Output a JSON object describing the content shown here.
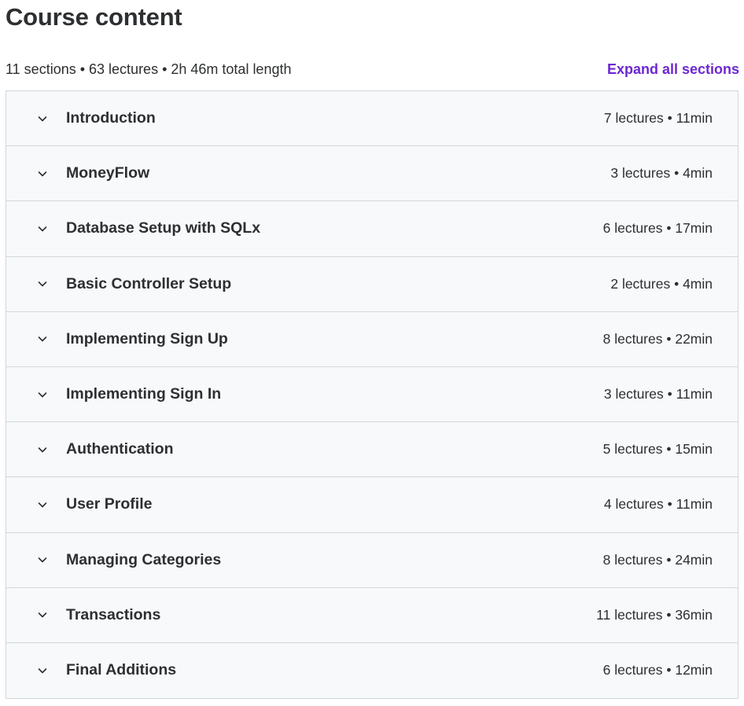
{
  "header": {
    "title": "Course content"
  },
  "summary": {
    "text": "11 sections • 63 lectures • 2h 46m total length",
    "expand_label": "Expand all sections"
  },
  "icons": {
    "section_toggle": "chevron-down-icon"
  },
  "colors": {
    "accent": "#6d28d2",
    "text": "#2d2f31",
    "section_bg": "#f7f9fa",
    "border": "#d1d7dc"
  },
  "sections": [
    {
      "title": "Introduction",
      "meta": "7 lectures • 11min"
    },
    {
      "title": "MoneyFlow",
      "meta": "3 lectures • 4min"
    },
    {
      "title": "Database Setup with SQLx",
      "meta": "6 lectures • 17min"
    },
    {
      "title": "Basic Controller Setup",
      "meta": "2 lectures • 4min"
    },
    {
      "title": "Implementing Sign Up",
      "meta": "8 lectures • 22min"
    },
    {
      "title": "Implementing Sign In",
      "meta": "3 lectures • 11min"
    },
    {
      "title": "Authentication",
      "meta": "5 lectures • 15min"
    },
    {
      "title": "User Profile",
      "meta": "4 lectures • 11min"
    },
    {
      "title": "Managing Categories",
      "meta": "8 lectures • 24min"
    },
    {
      "title": "Transactions",
      "meta": "11 lectures • 36min"
    },
    {
      "title": "Final Additions",
      "meta": "6 lectures • 12min"
    }
  ]
}
